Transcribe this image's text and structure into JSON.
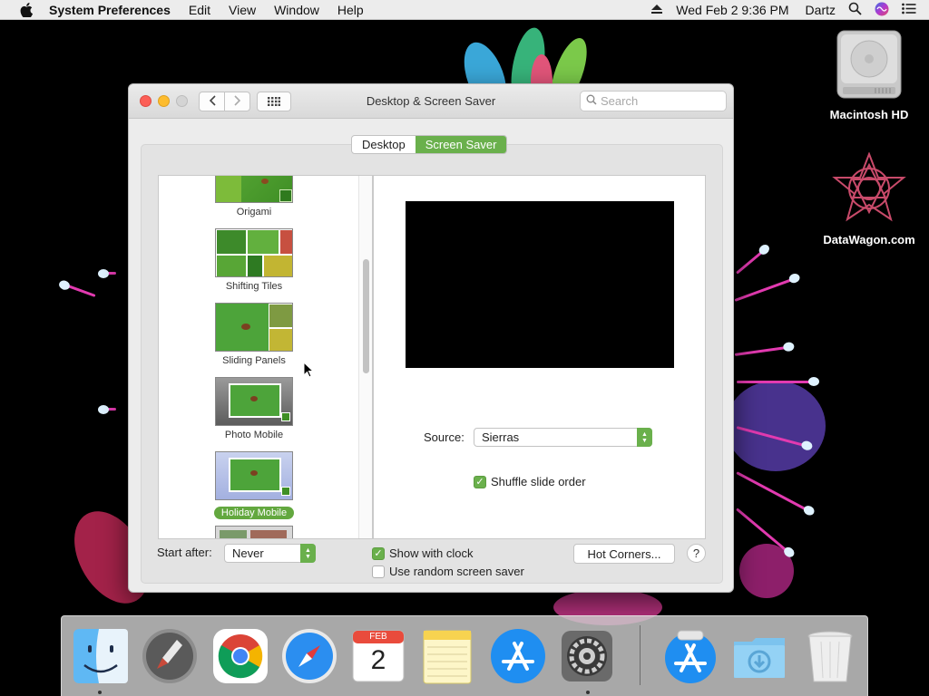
{
  "menubar": {
    "app_name": "System Preferences",
    "menus": [
      "Edit",
      "View",
      "Window",
      "Help"
    ],
    "clock": "Wed Feb 2  9:36 PM",
    "user": "Dartz",
    "icons": [
      "apple-icon",
      "eject-icon",
      "spotlight-icon",
      "siri-icon",
      "notification-center-icon"
    ]
  },
  "desktop_icons": [
    {
      "label": "Macintosh HD",
      "icon": "hard-drive-icon"
    },
    {
      "label": "DataWagon.com",
      "icon": "datawagon-logo-icon"
    }
  ],
  "window": {
    "title": "Desktop & Screen Saver",
    "search_placeholder": "Search",
    "tabs": [
      {
        "label": "Desktop",
        "active": false
      },
      {
        "label": "Screen Saver",
        "active": true
      }
    ],
    "screensavers": [
      {
        "label": "Origami",
        "selected": false
      },
      {
        "label": "Shifting Tiles",
        "selected": false
      },
      {
        "label": "Sliding Panels",
        "selected": false
      },
      {
        "label": "Photo Mobile",
        "selected": false
      },
      {
        "label": "Holiday Mobile",
        "selected": true
      }
    ],
    "source_label": "Source:",
    "source_value": "Sierras",
    "shuffle_label": "Shuffle slide order",
    "shuffle_checked": true,
    "start_after_label": "Start after:",
    "start_after_value": "Never",
    "show_clock_label": "Show with clock",
    "show_clock_checked": true,
    "random_label": "Use random screen saver",
    "random_checked": false,
    "hot_corners_label": "Hot Corners...",
    "help_label": "?",
    "accent_color": "#6ab04c"
  },
  "dock": {
    "items": [
      {
        "name": "Finder",
        "icon": "finder-icon",
        "running": true
      },
      {
        "name": "Launchpad",
        "icon": "launchpad-icon",
        "running": false
      },
      {
        "name": "Google Chrome",
        "icon": "chrome-icon",
        "running": false
      },
      {
        "name": "Safari",
        "icon": "safari-icon",
        "running": false
      },
      {
        "name": "Calendar",
        "icon": "calendar-icon",
        "running": false,
        "month": "FEB",
        "day": "2"
      },
      {
        "name": "Notes",
        "icon": "notes-icon",
        "running": false
      },
      {
        "name": "App Store",
        "icon": "app-store-icon",
        "running": false
      },
      {
        "name": "System Preferences",
        "icon": "system-preferences-icon",
        "running": true
      },
      {
        "name": "App Store Installer",
        "icon": "app-store-installer-icon",
        "running": false
      },
      {
        "name": "Downloads",
        "icon": "downloads-folder-icon",
        "running": false
      },
      {
        "name": "Trash",
        "icon": "trash-icon",
        "running": false
      }
    ]
  }
}
